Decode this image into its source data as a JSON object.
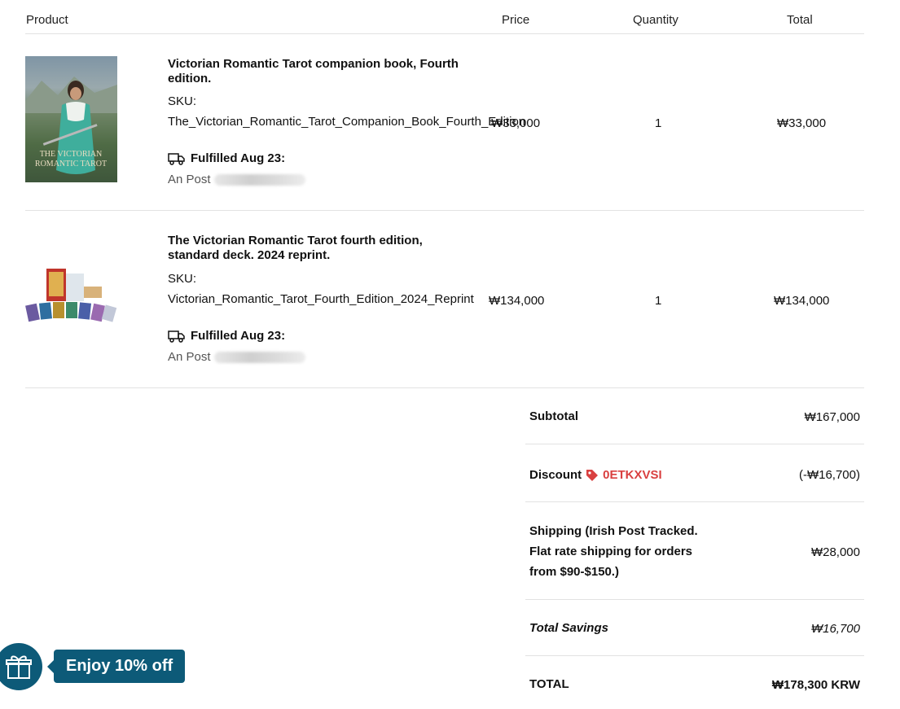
{
  "table": {
    "headers": {
      "product": "Product",
      "price": "Price",
      "quantity": "Quantity",
      "total": "Total"
    }
  },
  "items": [
    {
      "name": "Victorian Romantic Tarot companion book, Fourth edition.",
      "sku_label": "SKU:",
      "sku": "The_Victorian_Romantic_Tarot_Companion_Book_Fourth_Edition",
      "fulfilled": "Fulfilled Aug 23:",
      "carrier": "An Post",
      "price": "₩33,000",
      "quantity": "1",
      "total": "₩33,000",
      "thumb_text": "The Victorian Romantic Tarot"
    },
    {
      "name": "The Victorian Romantic Tarot fourth edition, standard deck. 2024 reprint.",
      "sku_label": "SKU:",
      "sku": "Victorian_Romantic_Tarot_Fourth_Edition_2024_Reprint",
      "fulfilled": "Fulfilled Aug 23:",
      "carrier": "An Post",
      "price": "₩134,000",
      "quantity": "1",
      "total": "₩134,000"
    }
  ],
  "summary": {
    "subtotal_label": "Subtotal",
    "subtotal": "₩167,000",
    "discount_label": "Discount",
    "discount_code": "0ETKXVSI",
    "discount": "(-₩16,700)",
    "shipping_label": "Shipping (Irish Post Tracked. Flat rate shipping for orders from $90-$150.)",
    "shipping": "₩28,000",
    "savings_label": "Total Savings",
    "savings": "₩16,700",
    "total_label": "TOTAL",
    "total": "₩178,300 KRW"
  },
  "promo": {
    "label": "Enjoy 10% off",
    "icon": "gift-icon"
  },
  "colors": {
    "accent": "#0d5a78",
    "discount": "#d94040"
  }
}
